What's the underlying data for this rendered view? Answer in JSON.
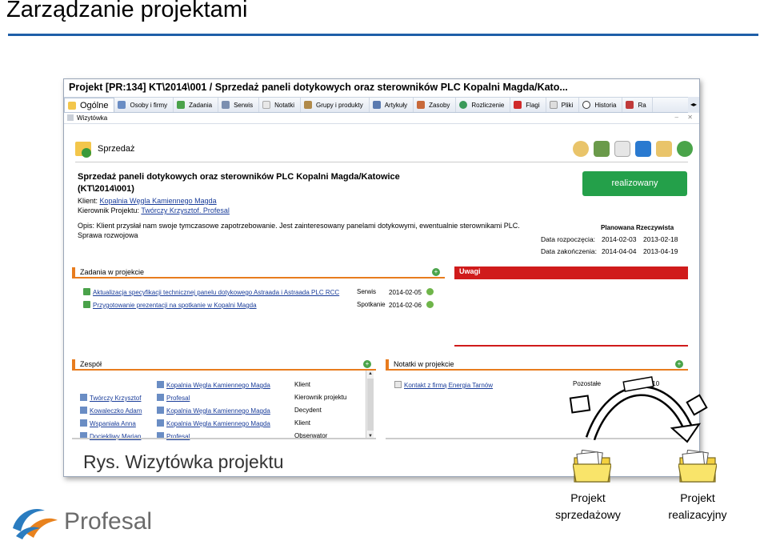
{
  "slide": {
    "title": "Zarządzanie projektami",
    "caption": "Rys. Wizytówka projektu",
    "logo_text": "Profesal",
    "accent_color": "#1f5fa8"
  },
  "window": {
    "title": "Projekt [PR:134] KT\\2014\\001 / Sprzedaż paneli dotykowych oraz sterowników PLC Kopalni Magda/Kato...",
    "tabs": [
      "Ogólne",
      "Osoby i firmy",
      "Zadania",
      "Serwis",
      "Notatki",
      "Grupy i produkty",
      "Artykuły",
      "Zasoby",
      "Rozliczenie",
      "Flagi",
      "Pliki",
      "Historia",
      "Ra"
    ],
    "subtab": "Wizytówka",
    "section_title": "Sprzedaż"
  },
  "project": {
    "name": "Sprzedaż paneli dotykowych oraz sterowników PLC Kopalni Magda/Katowice (KT\\2014\\001)",
    "client_label": "Klient:",
    "client": "Kopalnia Węgla Kamiennego Magda",
    "manager_label": "Kierownik Projektu:",
    "manager": "Twórczy Krzysztof. Profesal",
    "description_line1": "Opis: Klient przysłał nam swoje tymczasowe zapotrzebowanie. Jest zainteresowany panelami dotykowymi, ewentualnie sterownikami PLC.",
    "description_line2": "Sprawa rozwojowa",
    "status": "realizowany",
    "status_color": "#24a04a"
  },
  "dates": {
    "header": "Planowana Rzeczywista",
    "start_label": "Data rozpoczęcia:",
    "start_planned": "2014-02-03",
    "start_actual": "2013-02-18",
    "end_label": "Data zakończenia:",
    "end_planned": "2014-04-04",
    "end_actual": "2013-04-19"
  },
  "tasks_panel": {
    "title": "Zadania w projekcie",
    "items": [
      {
        "name": "Aktualizacja specyfikacji technicznej panelu dotykowego Astraada i Astraada PLC RCC",
        "type": "Serwis",
        "date": "2014-02-05"
      },
      {
        "name": "Przygotowanie prezentacji na spotkanie w Kopalni Magda",
        "type": "Spotkanie",
        "date": "2014-02-06"
      }
    ]
  },
  "notes_panel_title": "Uwagi",
  "team_panel": {
    "title": "Zespół",
    "rows": [
      {
        "person": "",
        "company": "Kopalnia Węgla Kamiennego Magda",
        "role": "Klient"
      },
      {
        "person": "Twórczy Krzysztof",
        "company": "Profesal",
        "role": "Kierownik projektu"
      },
      {
        "person": "Kowaleczko Adam",
        "company": "Kopalnia Węgla Kamiennego Magda",
        "role": "Decydent"
      },
      {
        "person": "Wspaniała Anna",
        "company": "Kopalnia Węgla Kamiennego Magda",
        "role": "Klient"
      },
      {
        "person": "Dociekliwy Marian",
        "company": "Profesal",
        "role": "Obserwator"
      }
    ]
  },
  "project_notes_panel": {
    "title": "Notatki w projekcie",
    "items": [
      {
        "name": "Kontakt z firmą Energia Tarnów",
        "category": "Pozostałe",
        "date": "...-10"
      }
    ]
  },
  "diagram": {
    "from_label_1": "Projekt",
    "from_label_2": "sprzedażowy",
    "to_label_1": "Projekt",
    "to_label_2": "realizacyjny"
  }
}
